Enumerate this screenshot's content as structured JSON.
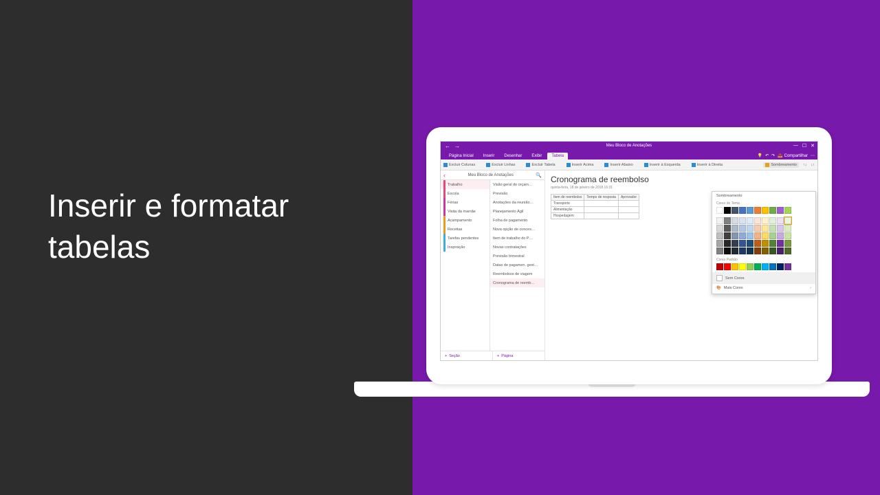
{
  "slide": {
    "title": "Inserir e formatar tabelas"
  },
  "colors": {
    "accent": "#7719aa",
    "dark": "#2d2d2d"
  },
  "app": {
    "title": "Meu Bloco de Anotações",
    "titlebar_icons": {
      "back": "←",
      "forward": "→",
      "min": "—",
      "max": "☐",
      "close": "✕"
    },
    "tabs": {
      "items": [
        "Página Inicial",
        "Inserir",
        "Desenhar",
        "Exibir",
        "Tabela"
      ],
      "active_index": 4
    },
    "tabs_right": {
      "tell_me_icon": "💡",
      "undo_icon": "↶",
      "redo_icon": "↷",
      "share_icon": "📤",
      "share": "Compartilhar",
      "more_icon": "⋯"
    },
    "ribbon": {
      "items": [
        {
          "icon": "#2a8dd4",
          "label": "Excluir Colunas"
        },
        {
          "icon": "#2a8dd4",
          "label": "Excluir Linhas"
        },
        {
          "icon": "#2a8dd4",
          "label": "Excluir Tabela"
        },
        {
          "icon": "#2a8dd4",
          "label": "Inserir Acima"
        },
        {
          "icon": "#2a8dd4",
          "label": "Inserir Abaixo"
        },
        {
          "icon": "#2a8dd4",
          "label": "Inserir à Esquerda"
        },
        {
          "icon": "#2a8dd4",
          "label": "Inserir à Direita"
        }
      ],
      "right": {
        "shading": "Sombreamento",
        "sort_icon1": "↑↓",
        "sort_icon2": "↓↑"
      }
    },
    "nav": {
      "back_icon": "‹",
      "title": "Meu Bloco de Anotações",
      "search_icon": "🔍",
      "sections": [
        {
          "color": "#e8467c",
          "label": "Trabalho",
          "selected": true
        },
        {
          "color": "#e8467c",
          "label": "Escola"
        },
        {
          "color": "#c43aa0",
          "label": "Férias"
        },
        {
          "color": "#c43aa0",
          "label": "Visita da mamãe"
        },
        {
          "color": "#e89b20",
          "label": "Acampamento"
        },
        {
          "color": "#e89b20",
          "label": "Receitas"
        },
        {
          "color": "#3bafda",
          "label": "Tarefas pendentes"
        },
        {
          "color": "#3bafda",
          "label": "Inspiração"
        }
      ],
      "pages": [
        "Visão geral do orçam…",
        "Previsão",
        "Anotações da reunião…",
        "Planejamento Ágil",
        "Folha de pagamento",
        "Nova opção de conces…",
        "Item de trabalho do P…",
        "Novas contratações",
        "Previsão trimestral",
        "Datas de pagamen. gest…",
        "Reembolsos de viagem",
        "Cronograma de reemb…"
      ],
      "pages_selected_index": 11,
      "footer": {
        "add_section": "Seção",
        "add_page": "Página",
        "add_icon": "+"
      }
    },
    "page": {
      "title": "Cronograma de reembolso",
      "meta": "quinta-feira, 18 de janeiro de 2018    16:31",
      "table": {
        "headers": [
          "Item de reembolso",
          "Tempo de resposta",
          "Aprovador"
        ],
        "rows": [
          [
            "Transporte",
            "",
            ""
          ],
          [
            "Alimentação",
            "",
            ""
          ],
          [
            "Hospedagem",
            "",
            ""
          ]
        ]
      }
    },
    "panel": {
      "title": "Sombreamento",
      "section_theme": "Cores do Tema",
      "section_standard": "Cores Padrão",
      "theme_row1": [
        "#ffffff",
        "#000000",
        "#44546a",
        "#4472c4",
        "#5b9bd5",
        "#ed7d31",
        "#ffc000",
        "#70ad47",
        "#9e5ecf",
        "#a5d653"
      ],
      "theme_shades": [
        [
          "#f2f2f2",
          "#7f7f7f",
          "#d6dce5",
          "#d9e2f3",
          "#deebf7",
          "#fbe5d6",
          "#fff2cc",
          "#e2efda",
          "#ece0f4",
          "#eef6de"
        ],
        [
          "#d9d9d9",
          "#595959",
          "#adb9ca",
          "#b4c6e7",
          "#bdd7ee",
          "#f8cbad",
          "#ffe699",
          "#c5e0b4",
          "#d9c5ea",
          "#dceec0"
        ],
        [
          "#bfbfbf",
          "#404040",
          "#8497b0",
          "#8eaadb",
          "#9cc3e6",
          "#f4b183",
          "#ffd966",
          "#a9d18e",
          "#c5a9e0",
          "#cbe6a3"
        ],
        [
          "#a6a6a6",
          "#262626",
          "#333f50",
          "#2f5597",
          "#1f4e79",
          "#c55a11",
          "#bf9000",
          "#548235",
          "#7030a0",
          "#7a9a3d"
        ],
        [
          "#808080",
          "#0d0d0d",
          "#222a35",
          "#1f3864",
          "#13334f",
          "#843c0c",
          "#806000",
          "#385723",
          "#4a1f6b",
          "#526a28"
        ]
      ],
      "theme_selected": [
        0,
        9
      ],
      "standard": [
        "#c00000",
        "#ff0000",
        "#ffc000",
        "#ffff00",
        "#92d050",
        "#00b050",
        "#00b0f0",
        "#0070c0",
        "#002060",
        "#7030a0"
      ],
      "no_color": "Sem Cores",
      "more_colors": "Mais Cores",
      "more_icon": "🎨",
      "chev": "›"
    }
  }
}
